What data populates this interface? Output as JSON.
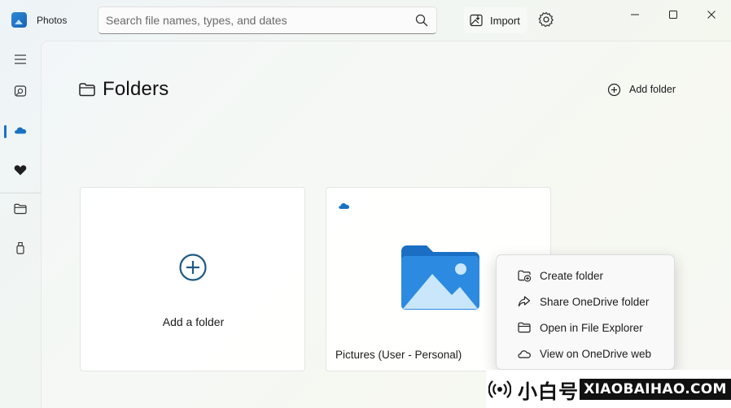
{
  "window": {
    "app_title": "Photos",
    "controls": {
      "minimize": "minimize-icon",
      "maximize": "maximize-icon",
      "close": "close-icon"
    }
  },
  "search": {
    "value": "",
    "placeholder": "Search file names, types, and dates",
    "icon": "search-icon"
  },
  "toolbar": {
    "import_label": "Import",
    "import_icon": "import-icon",
    "settings_icon": "gear-icon"
  },
  "nav_rail": {
    "items": [
      {
        "icon": "hamburger-menu-icon"
      },
      {
        "icon": "gallery-icon"
      },
      {
        "icon": "onedrive-cloud-icon",
        "selected": true
      },
      {
        "icon": "heart-icon"
      },
      {
        "icon": "folder-icon"
      },
      {
        "icon": "usb-drive-icon"
      }
    ]
  },
  "page": {
    "title": "Folders",
    "title_icon": "folder-outline-icon",
    "add_folder_label": "Add folder",
    "add_folder_icon": "plus-circle-icon"
  },
  "cards": {
    "add": {
      "label": "Add a folder",
      "icon": "plus-circle-icon"
    },
    "folder": {
      "label": "Pictures (User - Personal)",
      "badge_icon": "onedrive-cloud-icon",
      "thumbnail_icon": "pictures-folder-icon"
    }
  },
  "context_menu": {
    "items": [
      {
        "label": "Create folder",
        "icon": "new-folder-icon"
      },
      {
        "label": "Share OneDrive folder",
        "icon": "share-icon"
      },
      {
        "label": "Open in File Explorer",
        "icon": "file-explorer-folder-icon"
      },
      {
        "label": "View on OneDrive web",
        "icon": "cloud-outline-icon"
      }
    ]
  },
  "watermark": {
    "text_cn": "小白号",
    "site": "XIAOBAIHAO.COM"
  },
  "colors": {
    "accent": "#1872c3",
    "folder_blue": "#1f7ad4",
    "folder_light": "#bfe2fb",
    "text": "#1b1b1b"
  }
}
